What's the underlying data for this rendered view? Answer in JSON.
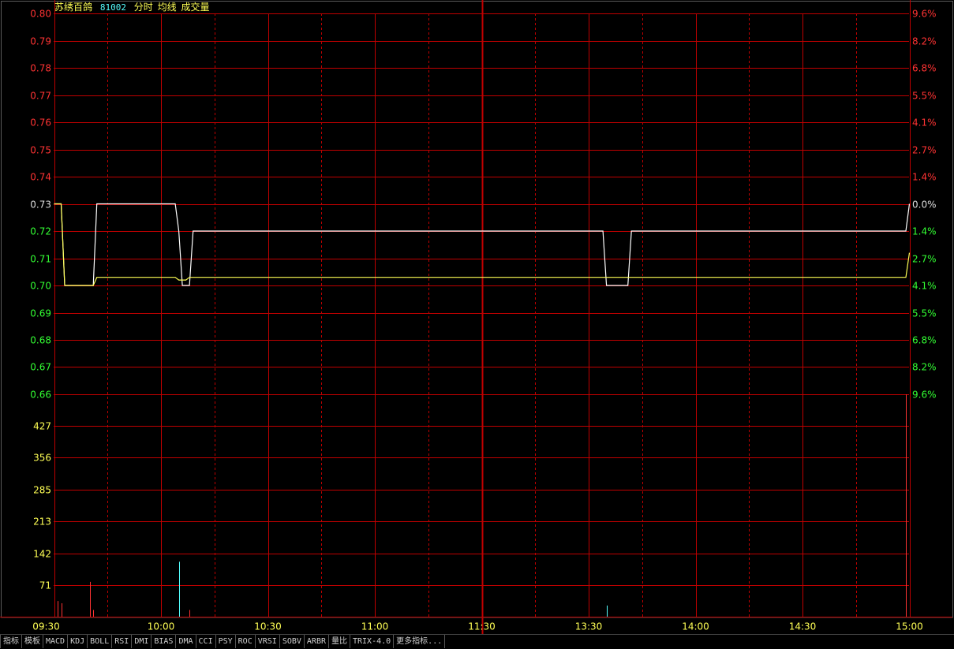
{
  "header": {
    "stock_name": "苏绣百鸽",
    "stock_code": "81002",
    "items": [
      "分时",
      "均线",
      "成交量"
    ]
  },
  "colors": {
    "grid": "#c00000",
    "price_line": "#ffffff",
    "avg_line": "#ffff55",
    "up": "#ff3333",
    "down": "#33ff33",
    "flat": "#dddddd",
    "volume_axis": "#ffff55"
  },
  "chart_data": {
    "type": "line",
    "time_labels": [
      "09:30",
      "10:00",
      "10:30",
      "11:00",
      "11:30",
      "13:30",
      "14:00",
      "14:30",
      "15:00"
    ],
    "price_axis": {
      "labels": [
        "0.80",
        "0.79",
        "0.78",
        "0.77",
        "0.76",
        "0.75",
        "0.74",
        "0.73",
        "0.72",
        "0.71",
        "0.70",
        "0.69",
        "0.68",
        "0.67",
        "0.66"
      ],
      "values": [
        0.8,
        0.79,
        0.78,
        0.77,
        0.76,
        0.75,
        0.74,
        0.73,
        0.72,
        0.71,
        0.7,
        0.69,
        0.68,
        0.67,
        0.66
      ],
      "reference": 0.73,
      "ylim": [
        0.66,
        0.8
      ]
    },
    "percent_axis": {
      "labels": [
        "9.6%",
        "8.2%",
        "6.8%",
        "5.5%",
        "4.1%",
        "2.7%",
        "1.4%",
        "0.0%",
        "1.4%",
        "2.7%",
        "4.1%",
        "5.5%",
        "6.8%",
        "8.2%",
        "9.6%"
      ]
    },
    "volume_axis": {
      "labels": [
        "427",
        "356",
        "285",
        "213",
        "142",
        "71"
      ],
      "values": [
        427,
        356,
        285,
        213,
        142,
        71
      ],
      "ylim": [
        0,
        498
      ]
    },
    "series": [
      {
        "key": "price",
        "x": [
          0,
          2,
          3,
          11,
          12,
          34,
          35,
          36,
          38,
          39,
          40,
          154,
          155,
          161,
          162,
          239,
          240
        ],
        "values": [
          0.73,
          0.73,
          0.7,
          0.7,
          0.73,
          0.73,
          0.72,
          0.7,
          0.7,
          0.72,
          0.72,
          0.72,
          0.7,
          0.7,
          0.72,
          0.72,
          0.73
        ]
      },
      {
        "key": "average",
        "x": [
          0,
          2,
          3,
          11,
          12,
          34,
          35,
          37,
          38,
          40,
          239,
          240
        ],
        "values": [
          0.73,
          0.73,
          0.7,
          0.7,
          0.703,
          0.703,
          0.702,
          0.702,
          0.703,
          0.703,
          0.703,
          0.712
        ]
      }
    ],
    "volume": [
      {
        "x": 1,
        "value": 35,
        "dir": "up"
      },
      {
        "x": 2,
        "value": 30,
        "dir": "up"
      },
      {
        "x": 10,
        "value": 78,
        "dir": "up"
      },
      {
        "x": 11,
        "value": 15,
        "dir": "up"
      },
      {
        "x": 35,
        "value": 123,
        "dir": "down"
      },
      {
        "x": 38,
        "value": 15,
        "dir": "up"
      },
      {
        "x": 155,
        "value": 25,
        "dir": "down"
      },
      {
        "x": 239,
        "value": 498,
        "dir": "up"
      }
    ]
  },
  "tabs": [
    "指标",
    "模板",
    "MACD",
    "KDJ",
    "BOLL",
    "RSI",
    "DMI",
    "BIAS",
    "DMA",
    "CCI",
    "PSY",
    "ROC",
    "VRSI",
    "SOBV",
    "ARBR",
    "量比",
    "TRIX-4.0",
    "更多指标..."
  ]
}
